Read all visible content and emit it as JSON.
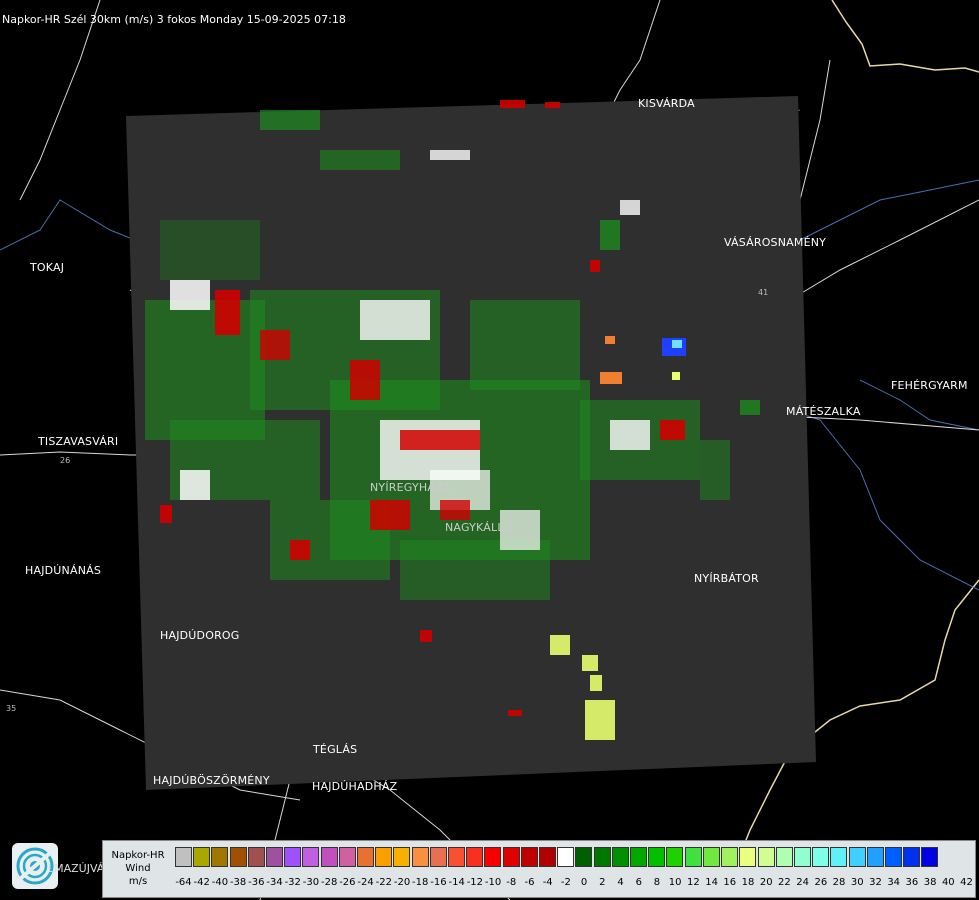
{
  "title": "Napkor-HR Szél 30km (m/s) 3 fokos Monday 15-09-2025 07:18",
  "cities": [
    {
      "name": "KISVÁRDA",
      "id": "kisvarda"
    },
    {
      "name": "TOKAJ",
      "id": "tokaj"
    },
    {
      "name": "VÁSÁROSNAMÉNY",
      "id": "vasarosnameny"
    },
    {
      "name": "FEHÉRGYARM",
      "id": "fehergyarmat"
    },
    {
      "name": "MÁTÉSZALKA",
      "id": "mateszalka"
    },
    {
      "name": "TISZAVASVÁRI",
      "id": "tiszavasvari"
    },
    {
      "name": "NYÍREGYHÁZA",
      "id": "nyiregyhaza"
    },
    {
      "name": "NAGYKÁLLÓ",
      "id": "nagykallo"
    },
    {
      "name": "NYÍRBÁTOR",
      "id": "nyirbator"
    },
    {
      "name": "HAJDÚNÁNÁS",
      "id": "hajdunanas"
    },
    {
      "name": "HAJDÚDOROG",
      "id": "hajdudorog"
    },
    {
      "name": "TÉGLÁS",
      "id": "teglas"
    },
    {
      "name": "HAJDÚBÖSZÖRMÉNY",
      "id": "hajduboszormeny"
    },
    {
      "name": "HAJDÚHADHÁZ",
      "id": "hajduhadhaz"
    }
  ],
  "routes": [
    "35",
    "26",
    "41"
  ],
  "logo": {
    "text": "LMAZÚJVÁR",
    "icon": "omsz-logo-icon"
  },
  "legend": {
    "title_lines": [
      "Napkor-HR",
      "Wind",
      "m/s"
    ],
    "colors": [
      "#c0c0c0",
      "#a8a800",
      "#a07800",
      "#a05000",
      "#a05050",
      "#a050a0",
      "#a050ff",
      "#c060e0",
      "#c050c0",
      "#d060a0",
      "#e87030",
      "#f8a000",
      "#f8b000",
      "#f89040",
      "#e87050",
      "#f85030",
      "#f83020",
      "#f80000",
      "#e00000",
      "#c00000",
      "#b00000",
      "#ffffff",
      "#006000",
      "#007800",
      "#009000",
      "#00a800",
      "#00c000",
      "#20d000",
      "#40e040",
      "#70e840",
      "#a0f060",
      "#e8ff80",
      "#d0ff90",
      "#b0ffb0",
      "#90ffd0",
      "#80ffe8",
      "#60f0f8",
      "#40d0ff",
      "#20a0ff",
      "#0060ff",
      "#0030f0",
      "#0000e0"
    ],
    "ticks": [
      "-64",
      "-42",
      "-40",
      "-38",
      "-36",
      "-34",
      "-32",
      "-30",
      "-28",
      "-26",
      "-24",
      "-22",
      "-20",
      "-18",
      "-16",
      "-14",
      "-12",
      "-10",
      "-8",
      "-6",
      "-4",
      "-2",
      "0",
      "2",
      "4",
      "6",
      "8",
      "10",
      "12",
      "14",
      "16",
      "18",
      "20",
      "22",
      "24",
      "26",
      "28",
      "30",
      "32",
      "34",
      "36",
      "38",
      "40",
      "42"
    ]
  }
}
